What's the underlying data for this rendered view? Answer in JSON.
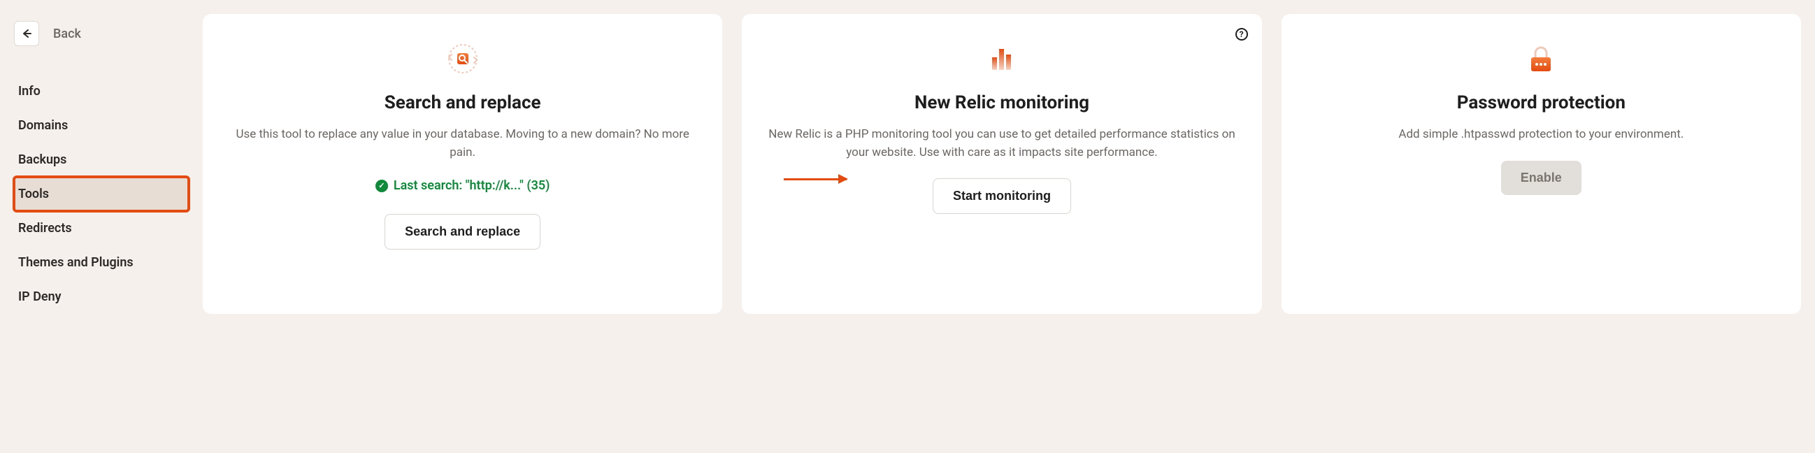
{
  "sidebar": {
    "back_label": "Back",
    "items": [
      "Info",
      "Domains",
      "Backups",
      "Tools",
      "Redirects",
      "Themes and Plugins",
      "IP Deny"
    ],
    "active_index": 3
  },
  "cards": {
    "search_replace": {
      "title": "Search and replace",
      "description": "Use this tool to replace any value in your database. Moving to a new domain? No more pain.",
      "last_search_text": "Last search: \"http://k...\" (35)",
      "button_label": "Search and replace"
    },
    "new_relic": {
      "title": "New Relic monitoring",
      "description": "New Relic is a PHP monitoring tool you can use to get detailed performance statistics on your website. Use with care as it impacts site performance.",
      "button_label": "Start monitoring"
    },
    "password_protection": {
      "title": "Password protection",
      "description": "Add simple .htpasswd protection to your environment.",
      "button_label": "Enable"
    }
  }
}
